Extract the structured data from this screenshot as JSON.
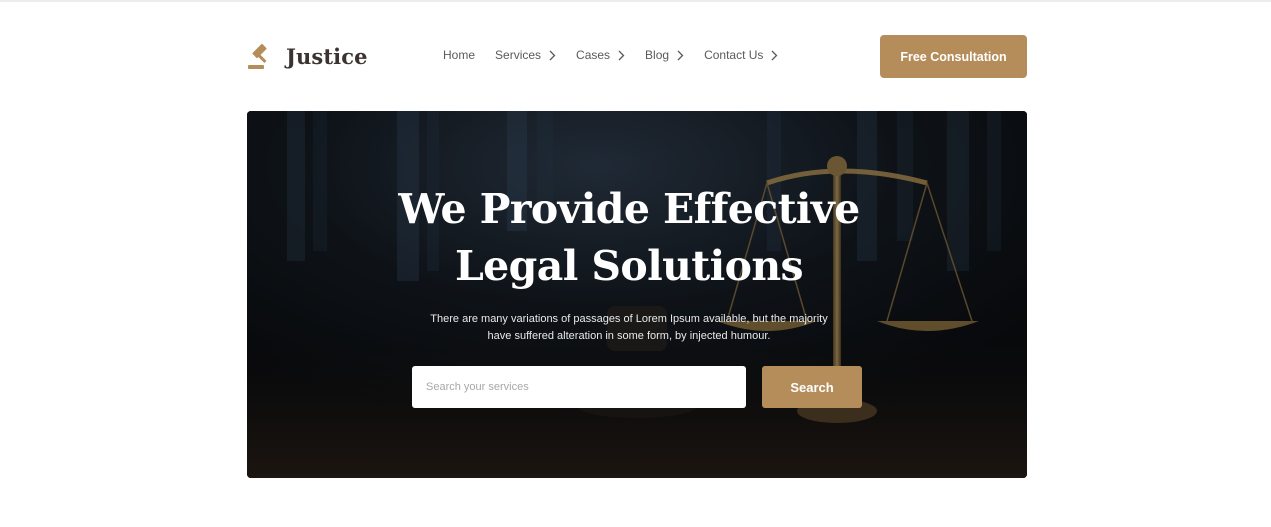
{
  "brand": {
    "name": "Justice",
    "icon": "gavel-icon",
    "accent_color": "#b58d5b"
  },
  "nav": {
    "items": [
      {
        "label": "Home",
        "has_chevron": false
      },
      {
        "label": "Services",
        "has_chevron": true
      },
      {
        "label": "Cases",
        "has_chevron": true
      },
      {
        "label": "Blog",
        "has_chevron": true
      },
      {
        "label": "Contact Us",
        "has_chevron": true
      }
    ]
  },
  "header": {
    "cta_label": "Free Consultation"
  },
  "hero": {
    "title_lines": [
      "We Provide Effective",
      "Legal Solutions"
    ],
    "subtitle_lines": [
      "There are many variations of passages of Lorem Ipsum available, but the majority",
      "have suffered alteration in some form, by injected humour."
    ],
    "search": {
      "placeholder": "Search your services",
      "value": "",
      "button_label": "Search"
    },
    "background": "scales-of-justice-and-gavel-image"
  }
}
